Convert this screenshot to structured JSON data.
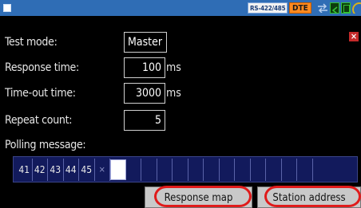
{
  "status_bar": {
    "interface_label": "RS-422/485",
    "mode_badge": "DTE",
    "colors": {
      "bar": "#2f6db5",
      "dte": "#ff8a1f",
      "green": "#37c237"
    }
  },
  "fields": {
    "test_mode": {
      "label": "Test mode:",
      "value": "Master"
    },
    "response_time": {
      "label": "Response time:",
      "value": "100",
      "unit": "ms"
    },
    "timeout_time": {
      "label": "Time-out time:",
      "value": "3000",
      "unit": "ms"
    },
    "repeat_count": {
      "label": "Repeat count:",
      "value": "5"
    },
    "polling_message": {
      "label": "Polling message:"
    }
  },
  "polling_bytes": [
    "41",
    "42",
    "43",
    "44",
    "45"
  ],
  "polling_separator": "×",
  "buttons": {
    "response_map": "Response map",
    "station_address": "Station address"
  },
  "icons": {
    "close": "close-icon",
    "stop": "stop-square-icon"
  }
}
